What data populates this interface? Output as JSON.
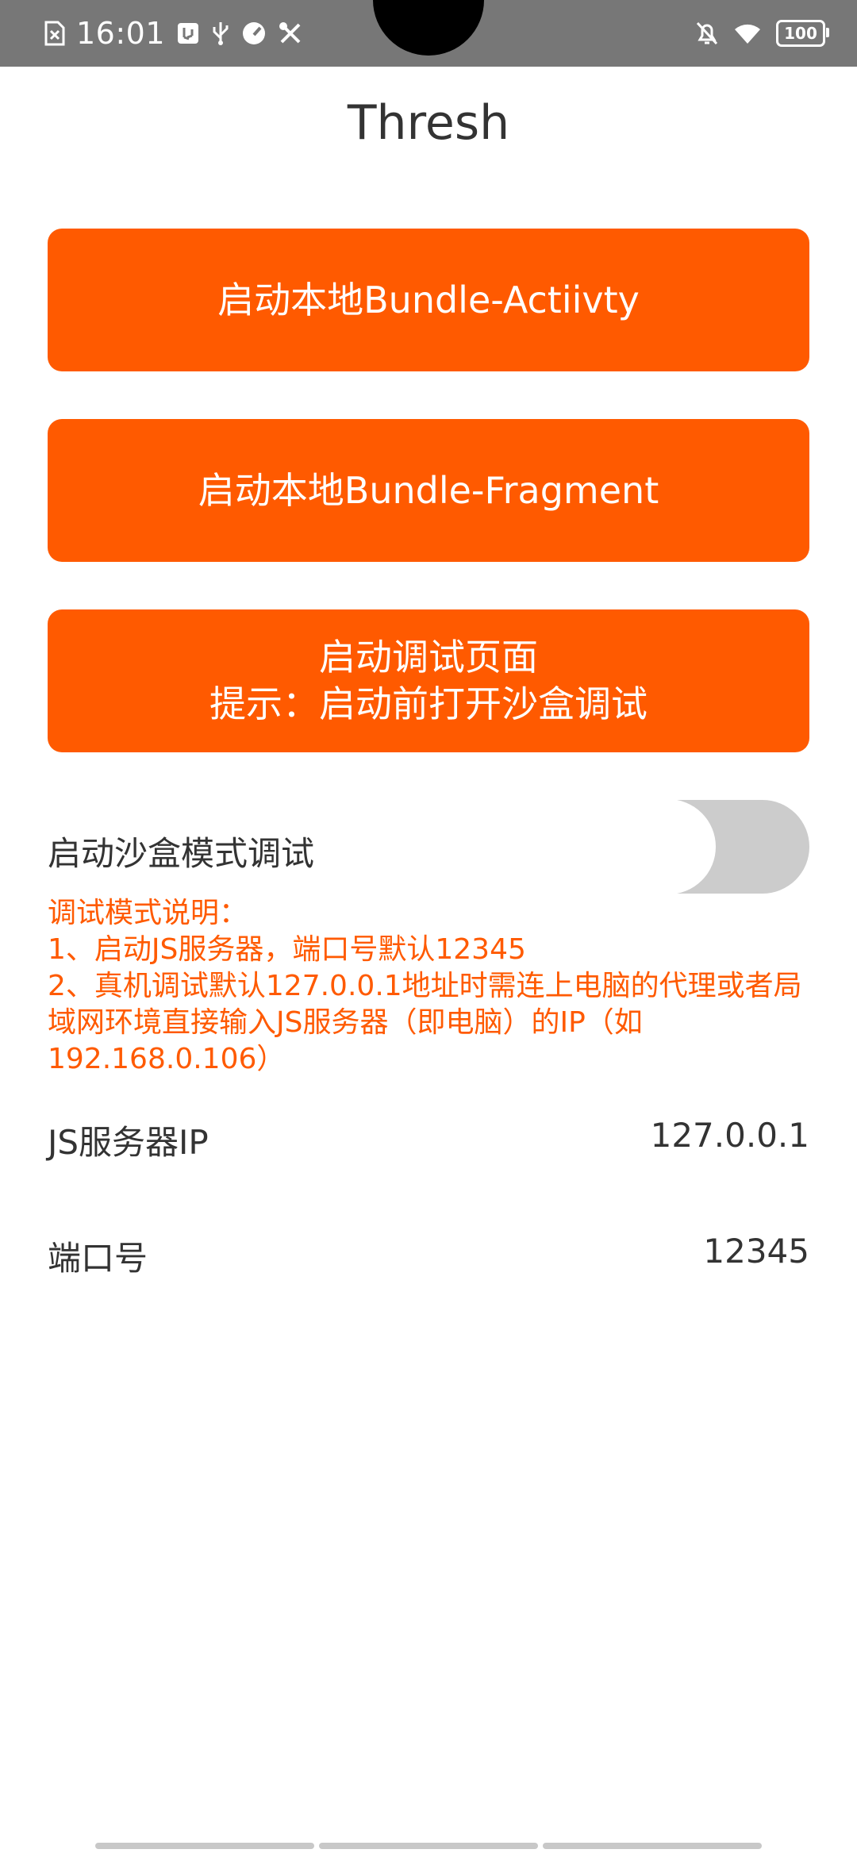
{
  "status_bar": {
    "time": "16:01",
    "battery": "100",
    "left_icons": [
      "file-close-icon",
      "usb-debug-icon",
      "usb-icon",
      "speedometer-icon",
      "tools-icon"
    ],
    "right_icons": [
      "bell-off-icon",
      "wifi-icon",
      "battery-icon"
    ]
  },
  "app": {
    "title": "Thresh"
  },
  "buttons": {
    "launch_activity": "启动本地Bundle-Actiivty",
    "launch_fragment": "启动本地Bundle-Fragment",
    "launch_debug_line1": "启动调试页面",
    "launch_debug_line2": "提示：启动前打开沙盒调试"
  },
  "sandbox": {
    "label": "启动沙盒模式调试",
    "enabled": false
  },
  "description": {
    "heading": "调试模式说明：",
    "line1": "1、启动JS服务器，端口号默认12345",
    "line2": "2、真机调试默认127.0.0.1地址时需连上电脑的代理或者局域网环境直接输入JS服务器（即电脑）的IP（如192.168.0.106）"
  },
  "server": {
    "ip_label": "JS服务器IP",
    "ip_value": "127.0.0.1",
    "port_label": "端口号",
    "port_value": "12345"
  },
  "colors": {
    "accent": "#ff5a00",
    "status_bar": "#777777",
    "text": "#333333",
    "toggle_off": "#cccccc"
  }
}
